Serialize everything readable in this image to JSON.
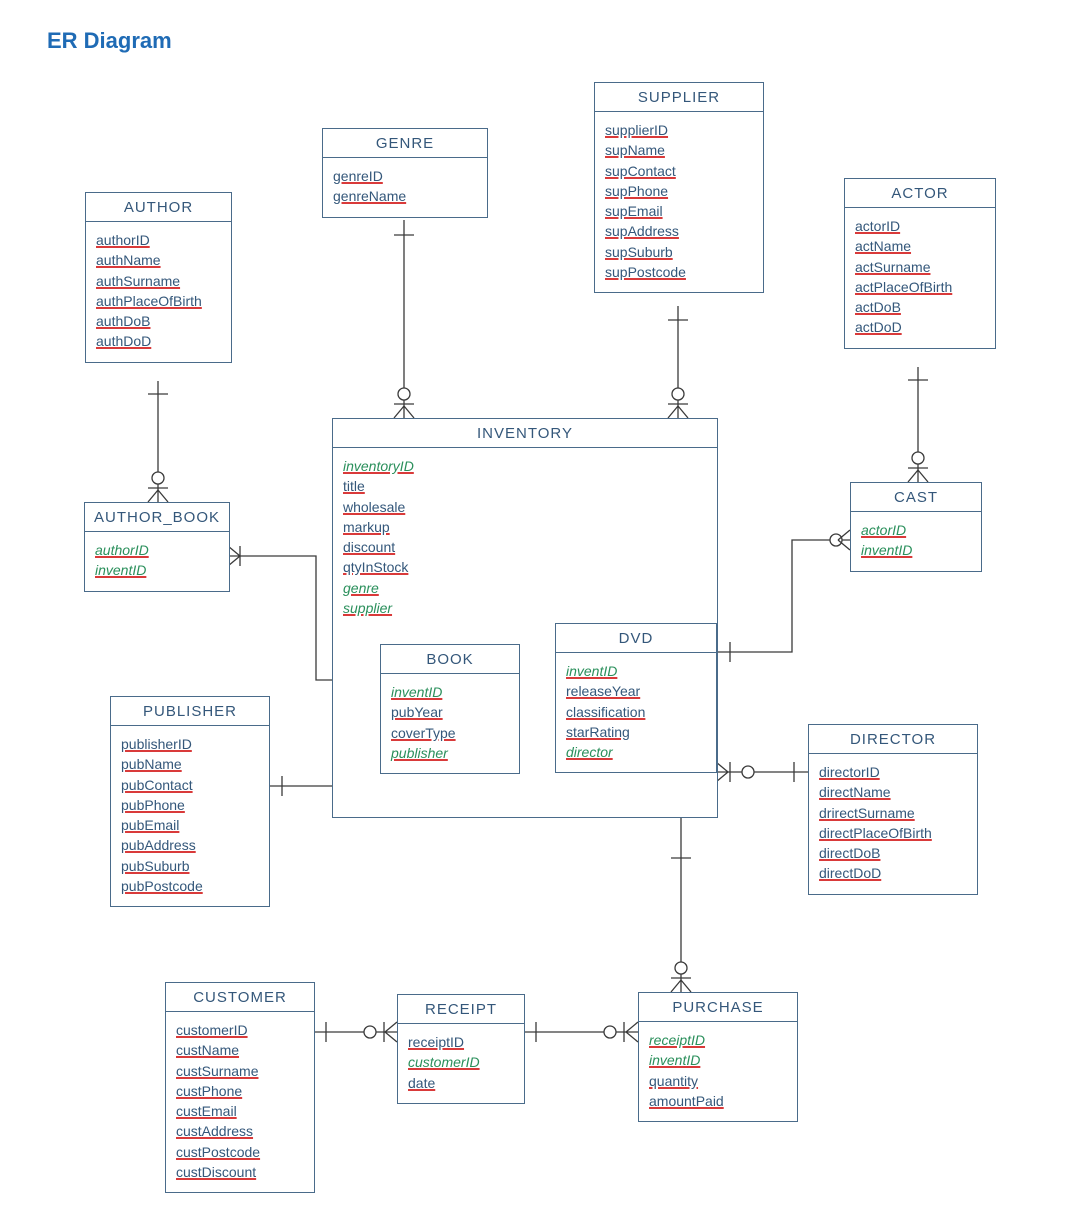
{
  "title": "ER Diagram",
  "entities": {
    "author": {
      "name": "AUTHOR",
      "attrs": [
        "authorID",
        "authName",
        "authSurname",
        "authPlaceOfBirth",
        "authDoB",
        "authDoD"
      ],
      "fk": []
    },
    "genre": {
      "name": "GENRE",
      "attrs": [
        "genreID",
        "genreName"
      ],
      "fk": []
    },
    "supplier": {
      "name": "SUPPLIER",
      "attrs": [
        "supplierID",
        "supName",
        "supContact",
        "supPhone",
        "supEmail",
        "supAddress",
        "supSuburb",
        "supPostcode"
      ],
      "fk": []
    },
    "actor": {
      "name": "ACTOR",
      "attrs": [
        "actorID",
        "actName",
        "actSurname",
        "actPlaceOfBirth",
        "actDoB",
        "actDoD"
      ],
      "fk": []
    },
    "authorbook": {
      "name": "AUTHOR_BOOK",
      "attrs": [
        "authorID",
        "inventID"
      ],
      "fk": [
        "authorID",
        "inventID"
      ]
    },
    "inventory": {
      "name": "INVENTORY",
      "attrs": [
        "inventoryID",
        "title",
        "wholesale",
        "markup",
        "discount",
        "qtyInStock",
        "genre",
        "supplier"
      ],
      "fk": [
        "inventoryID",
        "genre",
        "supplier"
      ]
    },
    "cast": {
      "name": "CAST",
      "attrs": [
        "actorID",
        "inventID"
      ],
      "fk": [
        "actorID",
        "inventID"
      ]
    },
    "book": {
      "name": "BOOK",
      "attrs": [
        "inventID",
        "pubYear",
        "coverType",
        "publisher"
      ],
      "fk": [
        "inventID",
        "publisher"
      ]
    },
    "dvd": {
      "name": "DVD",
      "attrs": [
        "inventID",
        "releaseYear",
        "classification",
        "starRating",
        "director"
      ],
      "fk": [
        "inventID",
        "director"
      ]
    },
    "publisher": {
      "name": "PUBLISHER",
      "attrs": [
        "publisherID",
        "pubName",
        "pubContact",
        "pubPhone",
        "pubEmail",
        "pubAddress",
        "pubSuburb",
        "pubPostcode"
      ],
      "fk": []
    },
    "director": {
      "name": "DIRECTOR",
      "attrs": [
        "directorID",
        "directName",
        "drirectSurname",
        "directPlaceOfBirth",
        "directDoB",
        "directDoD"
      ],
      "fk": []
    },
    "customer": {
      "name": "CUSTOMER",
      "attrs": [
        "customerID",
        "custName",
        "custSurname",
        "custPhone",
        "custEmail",
        "custAddress",
        "custPostcode",
        "custDiscount"
      ],
      "fk": []
    },
    "receipt": {
      "name": "RECEIPT",
      "attrs": [
        "receiptID",
        "customerID",
        "date"
      ],
      "fk": [
        "customerID"
      ]
    },
    "purchase": {
      "name": "PURCHASE",
      "attrs": [
        "receiptID",
        "inventID",
        "quantity",
        "amountPaid"
      ],
      "fk": [
        "receiptID",
        "inventID"
      ]
    }
  },
  "relationships": [
    {
      "from": "AUTHOR",
      "to": "AUTHOR_BOOK",
      "cardinality": "1..*–1"
    },
    {
      "from": "AUTHOR_BOOK",
      "to": "BOOK",
      "cardinality": "0..*–1"
    },
    {
      "from": "GENRE",
      "to": "INVENTORY",
      "cardinality": "1–1..*"
    },
    {
      "from": "SUPPLIER",
      "to": "INVENTORY",
      "cardinality": "1–1..*"
    },
    {
      "from": "ACTOR",
      "to": "CAST",
      "cardinality": "1–1..*"
    },
    {
      "from": "CAST",
      "to": "DVD",
      "cardinality": "0..*–1"
    },
    {
      "from": "PUBLISHER",
      "to": "BOOK",
      "cardinality": "1–0..*"
    },
    {
      "from": "DVD",
      "to": "DIRECTOR",
      "cardinality": "0..*–1"
    },
    {
      "from": "CUSTOMER",
      "to": "RECEIPT",
      "cardinality": "1–0..*"
    },
    {
      "from": "RECEIPT",
      "to": "PURCHASE",
      "cardinality": "1–0..*"
    },
    {
      "from": "INVENTORY",
      "to": "PURCHASE",
      "cardinality": "1–1..*"
    }
  ]
}
